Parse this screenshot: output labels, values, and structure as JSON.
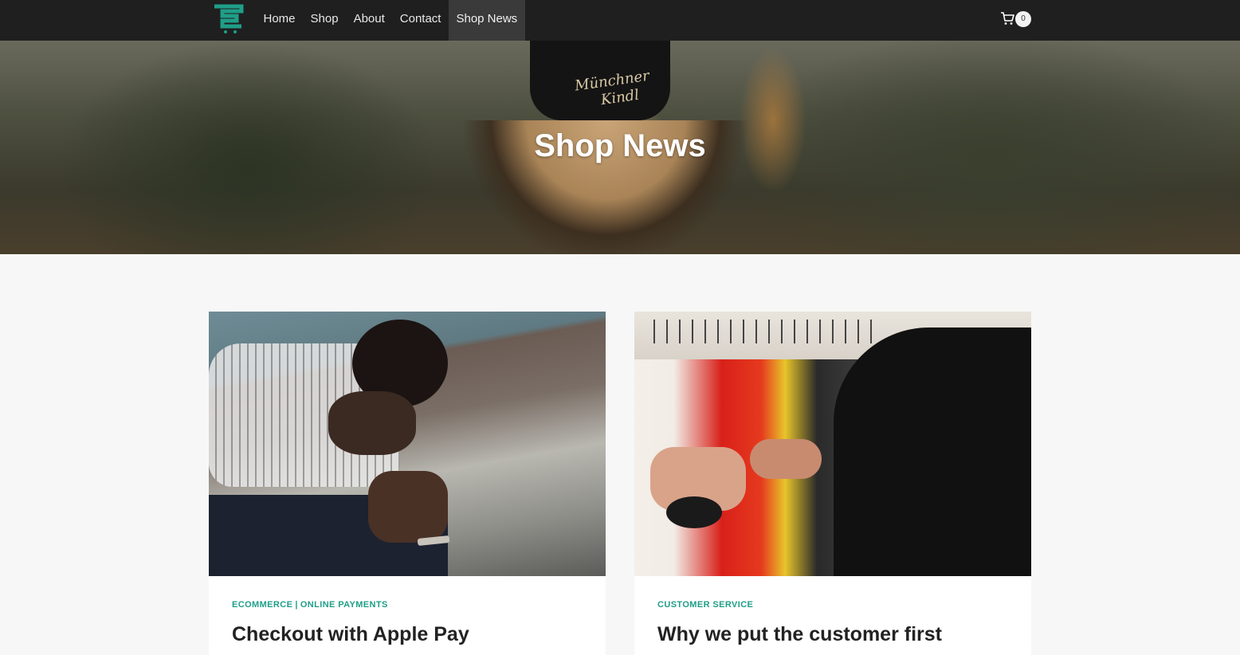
{
  "colors": {
    "header_bg": "#1f1f1f",
    "accent": "#1f9e88",
    "page_bg": "#f7f7f7",
    "active_nav_bg": "#3a3a3a"
  },
  "header": {
    "logo_icon": "shop-logo-icon",
    "nav": [
      {
        "label": "Home"
      },
      {
        "label": "Shop"
      },
      {
        "label": "About"
      },
      {
        "label": "Contact"
      },
      {
        "label": "Shop News",
        "active": true
      }
    ],
    "cart": {
      "icon": "cart-icon",
      "count": "0"
    }
  },
  "hero": {
    "title": "Shop News",
    "cap_text": "Münchner Kindl"
  },
  "posts": [
    {
      "categories": [
        "ECOMMERCE",
        "ONLINE PAYMENTS"
      ],
      "separator": "|",
      "title": "Checkout with Apple Pay"
    },
    {
      "categories": [
        "CUSTOMER SERVICE"
      ],
      "title": "Why we put the customer first"
    }
  ]
}
